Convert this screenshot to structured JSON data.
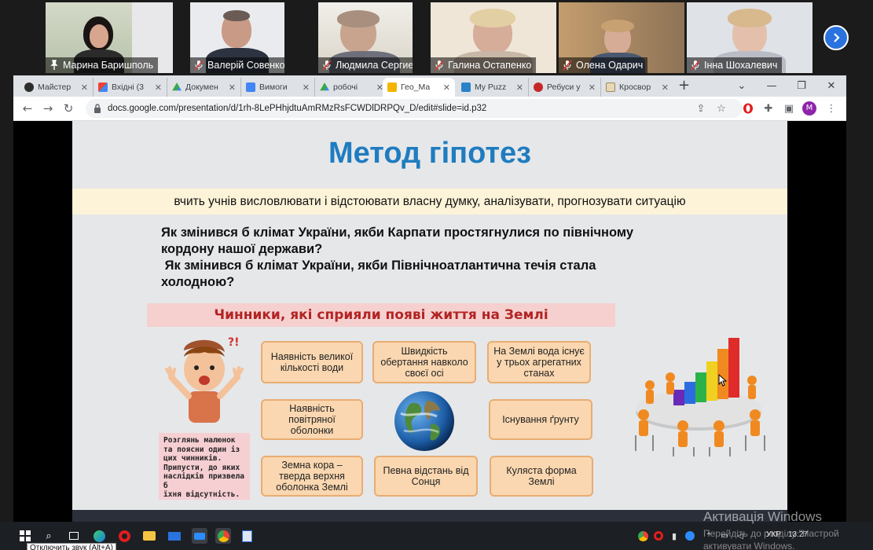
{
  "participants": [
    {
      "name": "Марина Баришполь",
      "muted": false,
      "pinned": true
    },
    {
      "name": "Валерій Совенко",
      "muted": true
    },
    {
      "name": "Людмила Сергиенко",
      "muted": true
    },
    {
      "name": "Галина Остапенко",
      "muted": true
    },
    {
      "name": "Олена Одарич",
      "muted": true
    },
    {
      "name": "Інна Шохалевич",
      "muted": true
    }
  ],
  "tabs": [
    {
      "label": "Майстер",
      "icon": "dark-app-icon"
    },
    {
      "label": "Вхідні (3",
      "icon": "gmail-icon"
    },
    {
      "label": "Докумен",
      "icon": "drive-icon"
    },
    {
      "label": "Вимоги",
      "icon": "docs-icon"
    },
    {
      "label": "робочі",
      "icon": "drive-icon"
    },
    {
      "label": "Гео_Ма",
      "icon": "slides-icon",
      "active": true
    },
    {
      "label": "My Puzz",
      "icon": "puzzle-icon"
    },
    {
      "label": "Ребуси у",
      "icon": "rebus-icon"
    },
    {
      "label": "Кросвор",
      "icon": "crossword-icon"
    }
  ],
  "browser": {
    "url": "docs.google.com/presentation/d/1rh-8LePHhjdtuAmRMzRsFCWDlDRPQv_D/edit#slide=id.p32",
    "profile_initial": "M"
  },
  "slide": {
    "title": "Метод гіпотез",
    "subtitle": "вчить учнів висловлювати і відстоювати власну думку, аналізувати, прогнозувати ситуацію",
    "question1_line1": "Як змінився б клімат України, якби Карпати простягнулися по північному",
    "question1_line2": "кордону нашої держави?",
    "question2_line1": " Як змінився б клімат України, якби Північноатлантична течія стала",
    "question2_line2": "холодною?",
    "factors_title": "Чинники, які сприяли появі життя на Землі",
    "factors": [
      "Наявність великої кількості води",
      "Швидкість обертання навколо своєї осі",
      "На Землі вода існує у трьох агрегатних станах",
      "Наявність повітряної оболонки",
      "Існування ґрунту",
      "Земна кора – тверда верхня оболонка Землі",
      "Певна відстань від Сонця",
      "Куляста форма Землі"
    ],
    "note_lines": [
      "Розглянь малюнок",
      "та поясни один із",
      "цих чинників.",
      "Припусти, до яких",
      "наслідків призвела б",
      "їхня відсутність."
    ],
    "colors": {
      "title": "#1f7cc0",
      "factors_title": "#b22424",
      "box_fill": "#fad7b0",
      "box_border": "#e8ad73"
    }
  },
  "taskbar": {
    "lang": "УКР",
    "time": "13:27"
  },
  "activation": {
    "line1": "Активація Windows",
    "line2": "Перейдіть до розділу \"Настрой",
    "line3": "активувати Windows."
  },
  "tooltip": "Отключить звук (Alt+A)"
}
